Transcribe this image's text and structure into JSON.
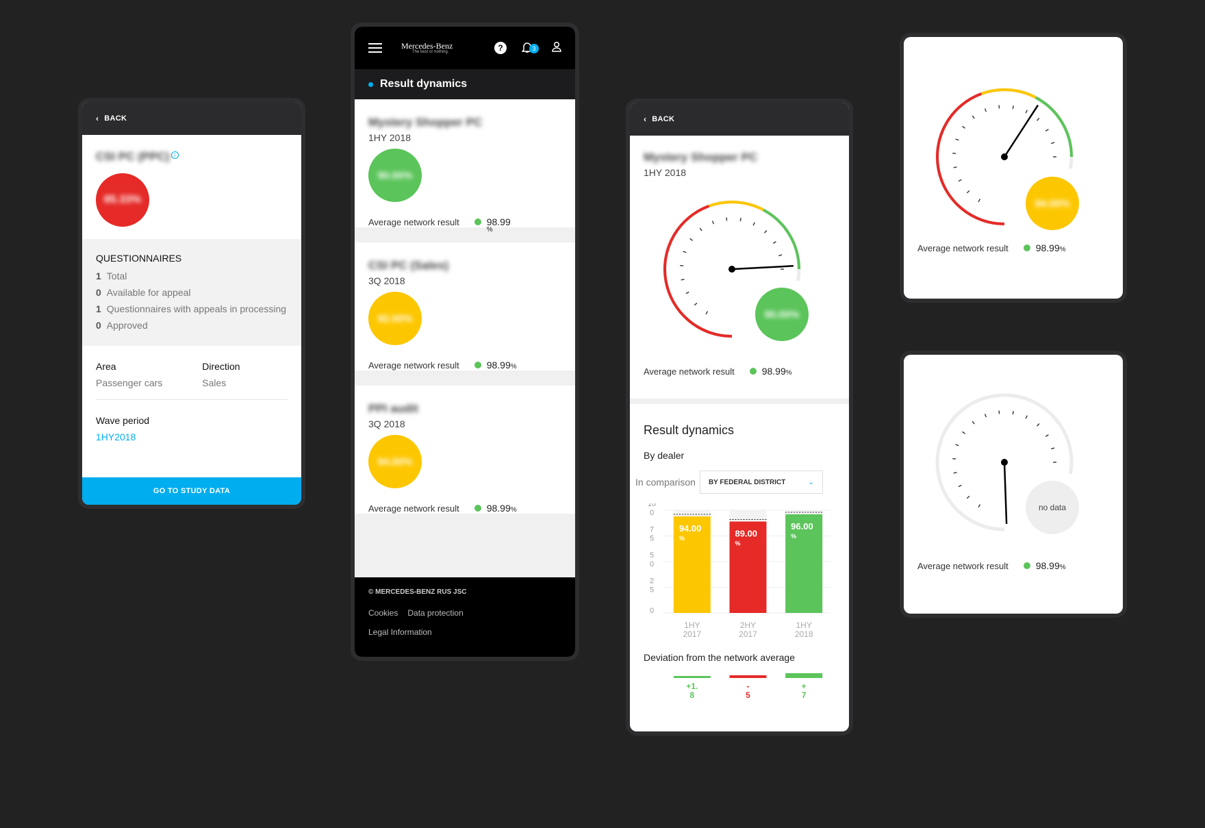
{
  "colors": {
    "bg": "#222223",
    "red": "#e52a27",
    "yellow": "#fdc700",
    "green": "#5bc45a",
    "blue": "#00adef"
  },
  "phone1": {
    "back": "BACK",
    "title": "CSI PC (PPC)",
    "score": "85.33%",
    "q_title": "QUESTIONNAIRES",
    "q_items": [
      {
        "n": "1",
        "label": "Total"
      },
      {
        "n": "0",
        "label": "Available for appeal"
      },
      {
        "n": "1",
        "label": "Questionnaires with appeals in processing"
      },
      {
        "n": "0",
        "label": "Approved"
      }
    ],
    "area_label": "Area",
    "area_value": "Passenger cars",
    "direction_label": "Direction",
    "direction_value": "Sales",
    "wave_label": "Wave period",
    "wave_value": "1HY2018",
    "cta": "GO TO STUDY DATA"
  },
  "phone2": {
    "brand": "Mercedes-Benz",
    "tagline": "The best or nothing.",
    "help_icon": "?",
    "notif_count": "3",
    "section_title": "Result dynamics",
    "cards": [
      {
        "title": "Mystery Shopper PC",
        "period": "1HY 2018",
        "score": "90.00%",
        "color": "green",
        "anr_label": "Average network result",
        "anr_value": "98.99",
        "anr_unit": "%"
      },
      {
        "title": "CSI PC (Sales)",
        "period": "3Q 2018",
        "score": "92.00%",
        "color": "yellow",
        "anr_label": "Average network result",
        "anr_value": "98.99",
        "anr_unit": "%"
      },
      {
        "title": "PPI audit",
        "period": "3Q 2018",
        "score": "94.00%",
        "color": "yellow",
        "anr_label": "Average network result",
        "anr_value": "98.99",
        "anr_unit": "%"
      }
    ],
    "footer": {
      "copyright": "© MERCEDES-BENZ RUS JSC",
      "links": [
        "Cookies",
        "Data protection",
        "Legal Information"
      ]
    }
  },
  "phone3": {
    "back": "BACK",
    "title": "Mystery Shopper PC",
    "period": "1HY 2018",
    "gauge_score": "90.00%",
    "anr_label": "Average network result",
    "anr_value": "98.99",
    "anr_unit": "%",
    "rd_title": "Result dynamics",
    "by_dealer": "By dealer",
    "comparison_label": "In comparison",
    "comparison_value": "BY FEDERAL DISTRICT",
    "deviation_title": "Deviation from the network average",
    "deviations": [
      {
        "line1": "+1.",
        "line2": "8",
        "color": "green"
      },
      {
        "line1": "-",
        "line2": "5",
        "color": "red"
      },
      {
        "line1": "+",
        "line2": "7",
        "color": "green"
      }
    ]
  },
  "chart_data": {
    "type": "bar",
    "categories": [
      "1HY 2017",
      "2HY 2017",
      "1HY 2018"
    ],
    "category_lines": [
      [
        "1HY",
        "2017"
      ],
      [
        "2HY",
        "2017"
      ],
      [
        "1HY",
        "2018"
      ]
    ],
    "values": [
      94.0,
      89.0,
      96.0
    ],
    "labels": [
      [
        "94.00",
        "%"
      ],
      [
        "89.00",
        "%"
      ],
      [
        "96.00",
        "%"
      ]
    ],
    "colors": [
      "#fdc700",
      "#e52a27",
      "#5bc45a"
    ],
    "ylim": [
      0,
      100
    ],
    "yticks": [
      [
        "10",
        "0"
      ],
      [
        "7",
        "5"
      ],
      [
        "5",
        "0"
      ],
      [
        "2",
        "5"
      ],
      [
        "0"
      ]
    ],
    "grid": true
  },
  "phone4": {
    "score": "94.00%",
    "anr_label": "Average network result",
    "anr_value": "98.99",
    "anr_unit": "%"
  },
  "phone5": {
    "no_data": "no data",
    "anr_label": "Average network result",
    "anr_value": "98.99",
    "anr_unit": "%"
  }
}
